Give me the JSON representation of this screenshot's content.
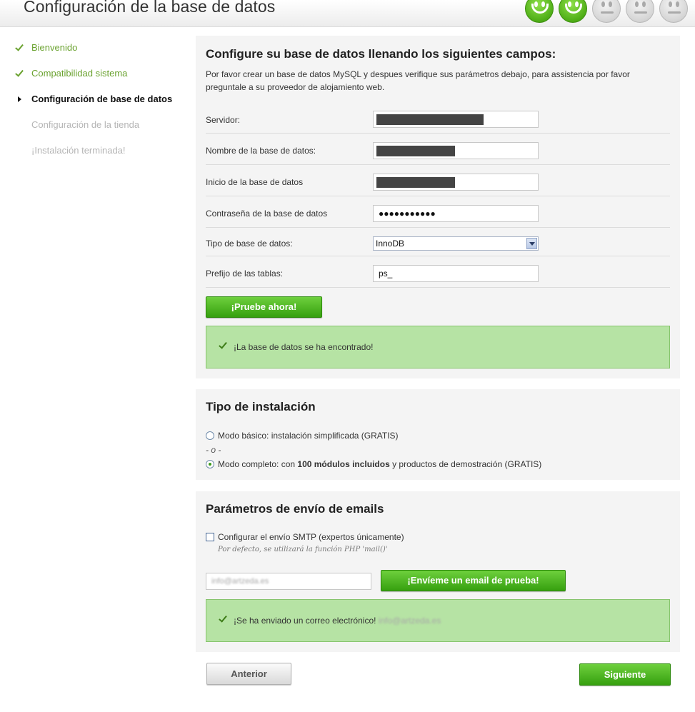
{
  "header": {
    "title": "Configuración de la base de datos"
  },
  "progress": {
    "icons": [
      "happy",
      "happy",
      "neutral",
      "neutral",
      "neutral"
    ],
    "completed_steps": 2,
    "total_steps": 5
  },
  "sidebar": {
    "steps": [
      {
        "label": "Bienvenido",
        "state": "done"
      },
      {
        "label": "Compatibilidad sistema",
        "state": "done"
      },
      {
        "label": "Configuración de base de datos",
        "state": "current"
      },
      {
        "label": "Configuración de la tienda",
        "state": "todo"
      },
      {
        "label": "¡Instalación terminada!",
        "state": "todo"
      }
    ]
  },
  "db_section": {
    "title": "Configure su base de datos llenando los siguientes campos:",
    "description": "Por favor crear un base de datos MySQL y despues verifique sus parámetros debajo, para assistencia por favor preguntale a su proveedor de alojamiento web.",
    "fields": {
      "server": {
        "label": "Servidor:"
      },
      "db_name": {
        "label": "Nombre de la base de datos:"
      },
      "db_login": {
        "label": "Inicio de la base de datos"
      },
      "db_password": {
        "label": "Contraseña de la base de datos",
        "masked_value": "●●●●●●●●●●●"
      },
      "db_type": {
        "label": "Tipo de base de datos:",
        "value": "InnoDB"
      },
      "table_prefix": {
        "label": "Prefijo de las tablas:",
        "value": "ps_"
      }
    },
    "test_button": "¡Pruebe ahora!",
    "success_message": "¡La base de datos se ha encontrado!"
  },
  "install_type": {
    "title": "Tipo de instalación",
    "basic_label": "Modo básico: instalación simplificada (GRATIS)",
    "or_text": "- o -",
    "full_prefix": "Modo completo: con ",
    "full_bold": "100 módulos incluidos",
    "full_suffix": " y productos de demostración (GRATIS)",
    "selected": "full"
  },
  "email_section": {
    "title": "Parámetros de envío de emails",
    "smtp_label": "Configurar el envío SMTP (expertos únicamente)",
    "smtp_checked": false,
    "hint": "Por defecto, se utilizará la función PHP 'mail()'",
    "email_value": "info@artzeda.es",
    "send_button": "¡Envíeme un email de prueba!",
    "sent_message": "¡Se ha enviado un correo electrónico!",
    "sent_email": "info@artzeda.es"
  },
  "nav": {
    "previous": "Anterior",
    "next": "Siguiente"
  },
  "colors": {
    "accent_green": "#4fae17",
    "success_bg": "#b6e3a4",
    "done_step": "#6aa22f"
  }
}
